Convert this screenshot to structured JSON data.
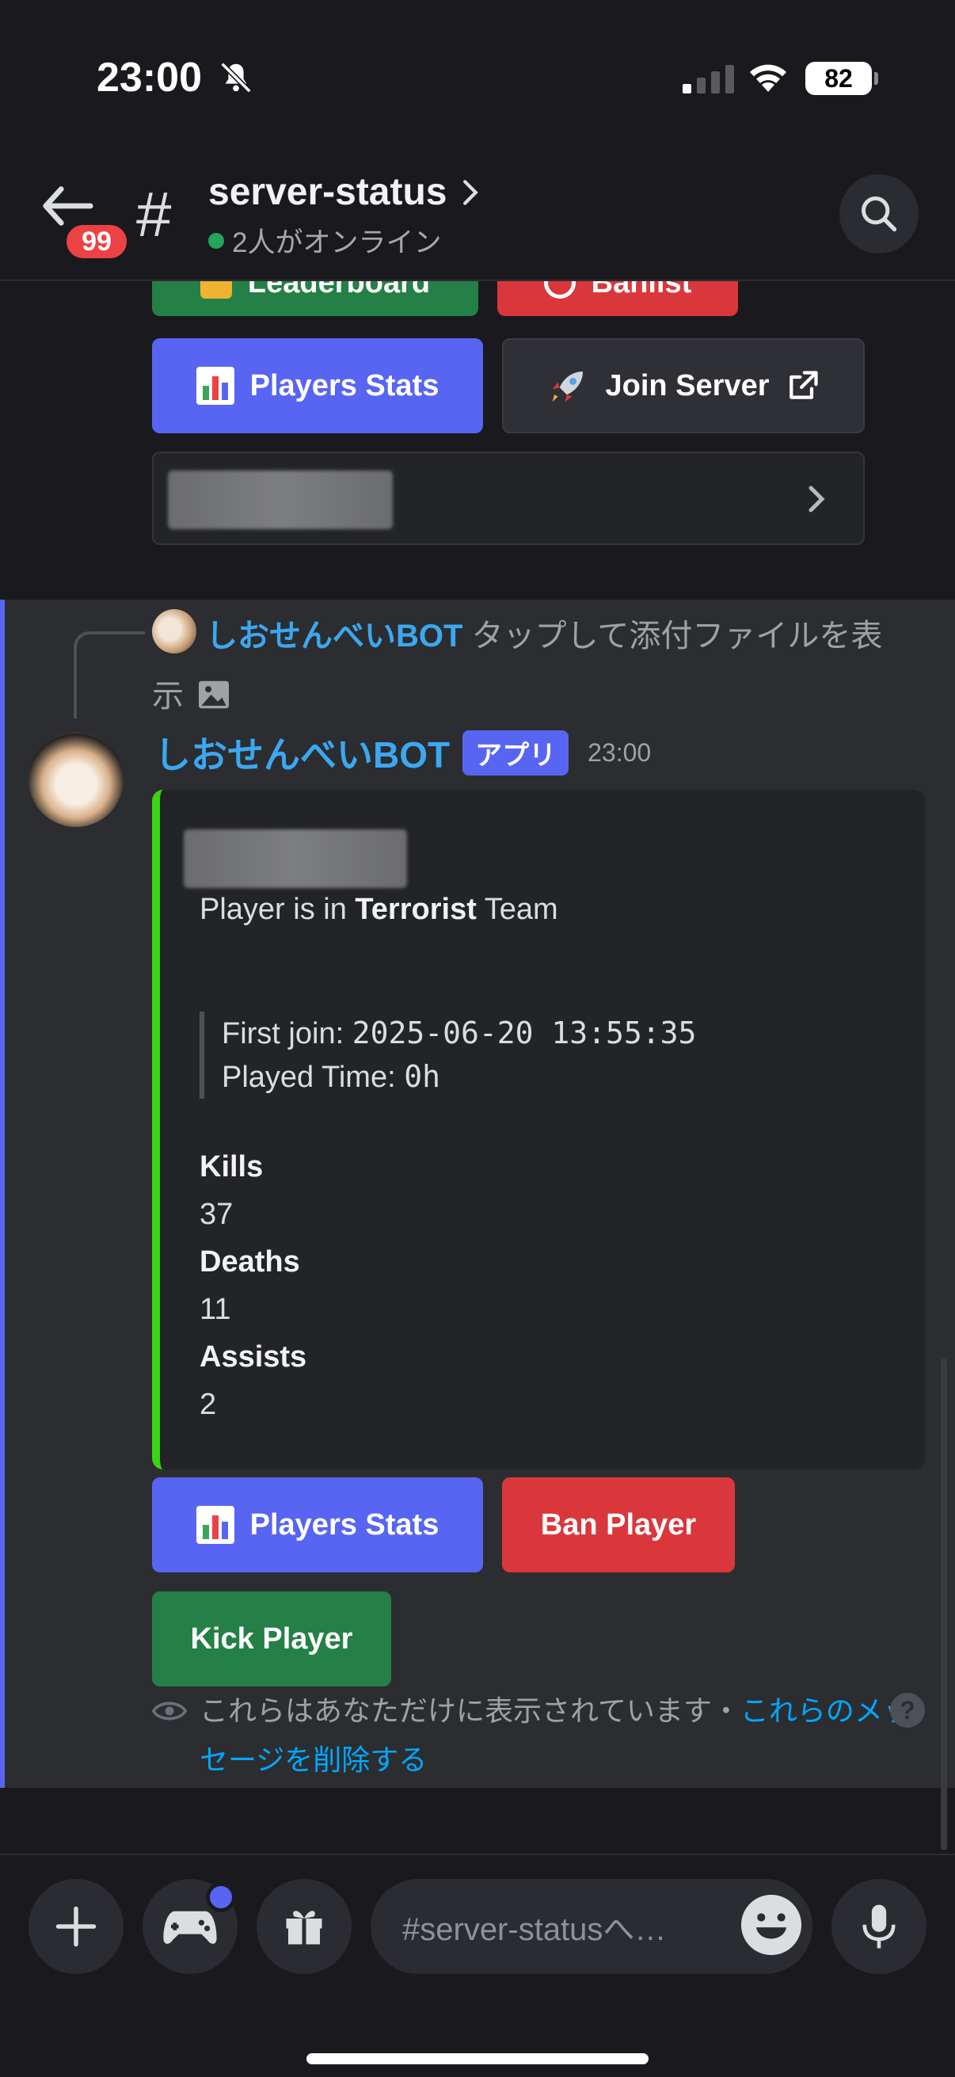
{
  "status_bar": {
    "time": "23:00",
    "battery": "82"
  },
  "header": {
    "unread_badge": "99",
    "hash": "#",
    "channel_name": "server-status",
    "online_text": "2人がオンライン"
  },
  "top_buttons": {
    "leaderboard_label": "Leaderboard",
    "banlist_label": "Banlist",
    "players_stats_label": "Players Stats",
    "join_server_label": "Join Server"
  },
  "reply": {
    "bot_name": "しおせんべいBOT",
    "text": "タップして添付ファイルを表示"
  },
  "message": {
    "author": "しおせんべいBOT",
    "app_tag": "アプリ",
    "timestamp": "23:00",
    "embed": {
      "desc_prefix": "Player  is in",
      "team": "Terrorist",
      "desc_suffix": "Team",
      "first_join_label": "First join:",
      "first_join_value": "2025-06-20 13:55:35",
      "played_time_label": "Played Time:",
      "played_time_value": "0h",
      "fields": [
        {
          "name": "Kills",
          "value": "37"
        },
        {
          "name": "Deaths",
          "value": "11"
        },
        {
          "name": "Assists",
          "value": "2"
        }
      ]
    },
    "buttons": {
      "players_stats_label": "Players Stats",
      "ban_label": "Ban Player",
      "kick_label": "Kick Player"
    },
    "ephemeral_text": "これらはあなただけに表示されています・",
    "ephemeral_link": "これらのメッセージを削除する"
  },
  "composer": {
    "placeholder": "#server-statusへ…"
  },
  "colors": {
    "blurple": "#5865f2",
    "green": "#248046",
    "red": "#da373c",
    "embed_accent": "#3ad513",
    "link": "#00a8fc"
  }
}
